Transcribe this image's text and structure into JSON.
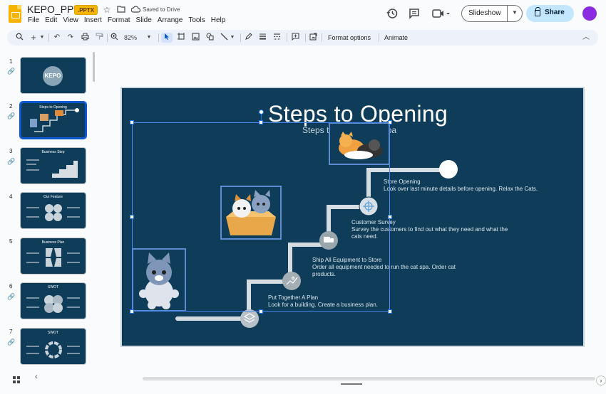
{
  "header": {
    "doc_title": "KEPO_PPTX",
    "file_badge": ".PPTX",
    "saved_status": "Saved to Drive",
    "menu": [
      "File",
      "Edit",
      "View",
      "Insert",
      "Format",
      "Slide",
      "Arrange",
      "Tools",
      "Help"
    ],
    "slideshow_label": "Slideshow",
    "share_label": "Share"
  },
  "toolbar": {
    "zoom": "82%",
    "format_options": "Format options",
    "animate": "Animate"
  },
  "filmstrip": {
    "slides": [
      {
        "num": "1",
        "title": "KEPO"
      },
      {
        "num": "2",
        "title": "Steps to Opening"
      },
      {
        "num": "3",
        "title": "Business Step"
      },
      {
        "num": "4",
        "title": "Our Feature"
      },
      {
        "num": "5",
        "title": "Business Plan"
      },
      {
        "num": "6",
        "title": "SWOT"
      },
      {
        "num": "7",
        "title": "SWOT"
      }
    ]
  },
  "slide": {
    "title": "Steps to Opening",
    "subtitle": "Steps to opening cat spa",
    "steps": [
      {
        "title": "Store Opening",
        "desc": "Look over last minute details before opening. Relax the Cats."
      },
      {
        "title": "Customer Survey",
        "desc": "Survey the customers to find out what they need and what the cats need."
      },
      {
        "title": "Ship All Equipment to Store",
        "desc": "Order all equipment needed to run the cat spa. Order cat products."
      },
      {
        "title": "Put Together A Plan",
        "desc": "Look for a building. Create a business plan."
      }
    ]
  },
  "colors": {
    "slide_bg": "#0f3d59",
    "accent_blue": "#0b57d0",
    "share_bg": "#c2e7ff",
    "badge_yellow": "#f4b400",
    "avatar": "#8a2be2"
  }
}
